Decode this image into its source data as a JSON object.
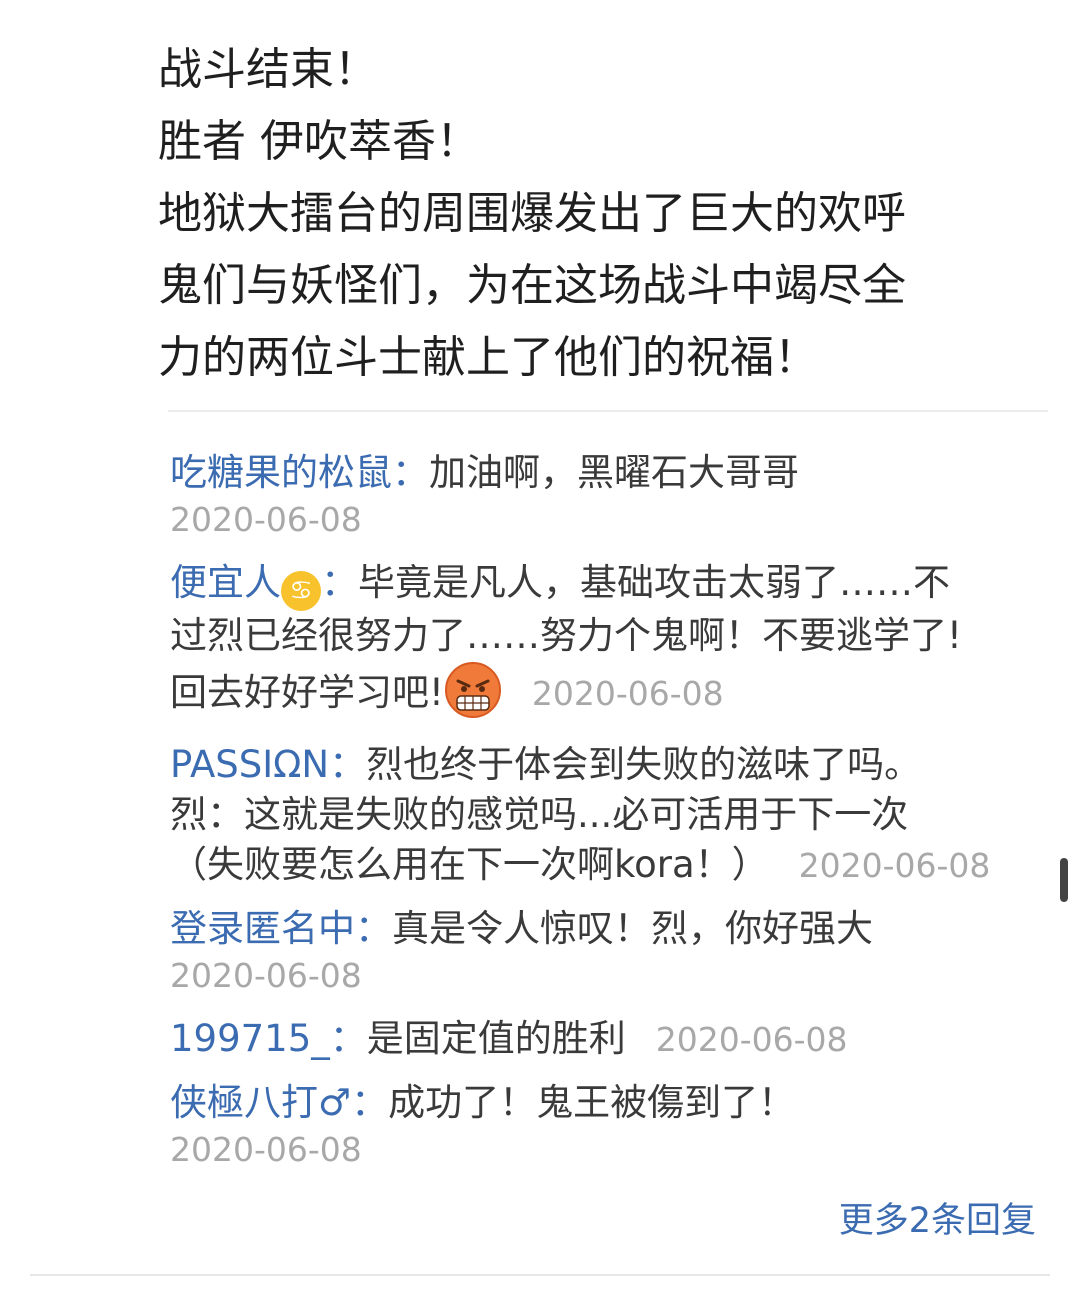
{
  "post": {
    "lines": [
      "战斗结束！",
      "胜者 伊吹萃香！",
      "地狱大擂台的周围爆发出了巨大的欢呼",
      "鬼们与妖怪们，为在这场战斗中竭尽全",
      "力的两位斗士献上了他们的祝福！"
    ]
  },
  "replies": [
    {
      "author": "吃糖果的松鼠",
      "separator": "：",
      "text": "加油啊，黑曜石大哥哥",
      "date": "2020-06-08"
    },
    {
      "author": "便宜人",
      "author_emoji": "cancer-zodiac-emoji",
      "author_emoji_glyph": "♋",
      "separator": "：",
      "text_line1": "毕竟是凡人，基础攻击太弱了……不",
      "text_line2": "过烈已经很努力了……努力个鬼啊！不要逃学了!",
      "text_line3": "回去好好学习吧!",
      "text_emoji": "angry-face-emoji",
      "date": "2020-06-08"
    },
    {
      "author": "PASSIΩN",
      "separator": "：",
      "text_line1": "烈也终于体会到失败的滋味了吗。",
      "text_line2": "烈：这就是失败的感觉吗...必可活用于下一次",
      "text_line3": "（失败要怎么用在下一次啊kora！）",
      "date": "2020-06-08"
    },
    {
      "author": "登录匿名中",
      "separator": "：",
      "text": "真是令人惊叹！烈，你好强大",
      "date": "2020-06-08"
    },
    {
      "author": "199715_",
      "separator": "：",
      "text": "是固定值的胜利",
      "date": "2020-06-08"
    },
    {
      "author": "侠極八打♂",
      "separator": "：",
      "text": "成功了！鬼王被傷到了！",
      "date": "2020-06-08"
    }
  ],
  "more_replies_label": "更多2条回复",
  "colors": {
    "author": "#3b6bb0",
    "date": "#a8a8a8",
    "body": "#1f1f1f"
  }
}
